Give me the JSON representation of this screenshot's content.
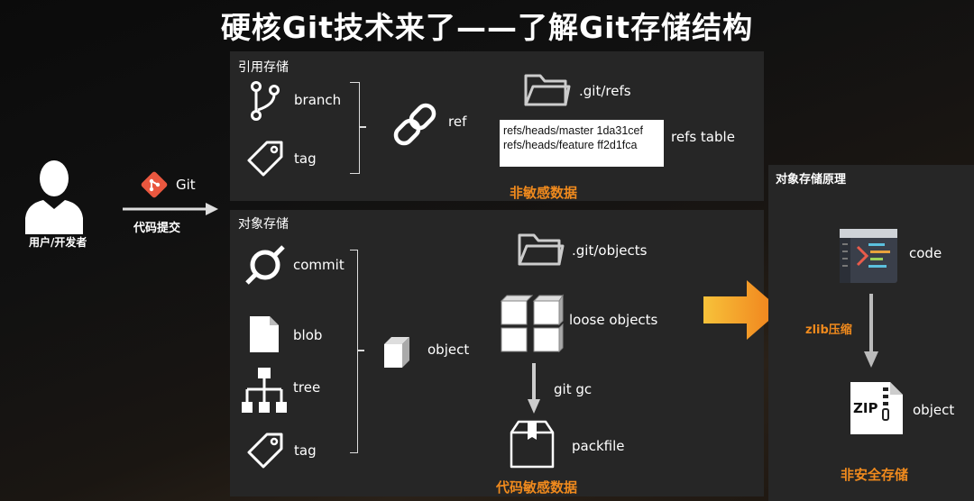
{
  "title": "硬核Git技术来了——了解Git存储结构",
  "user": {
    "label": "用户/开发者"
  },
  "git": {
    "label": "Git",
    "arrow_label": "代码提交"
  },
  "ref_panel": {
    "label": "引用存储",
    "items": [
      "branch",
      "tag"
    ],
    "ref_label": "ref",
    "folder_label": ".git/refs",
    "table_rows": [
      "refs/heads/master 1da31cef",
      "refs/heads/feature ff2d1fca"
    ],
    "table_label": "refs table",
    "sensitivity": "非敏感数据"
  },
  "object_panel": {
    "label": "对象存储",
    "items": [
      "commit",
      "blob",
      "tree",
      "tag"
    ],
    "object_label": "object",
    "folder_label": ".git/objects",
    "loose_label": "loose objects",
    "gc_label": "git gc",
    "packfile_label": "packfile",
    "sensitivity": "代码敏感数据"
  },
  "principle_panel": {
    "label": "对象存储原理",
    "code_label": "code",
    "compress_label": "zlib压缩",
    "object_label": "object",
    "zip_text": "ZIP",
    "security": "非安全存储"
  },
  "colors": {
    "accent": "#f08a1d",
    "panel": "#262626",
    "git_logo": "#e9573f"
  }
}
